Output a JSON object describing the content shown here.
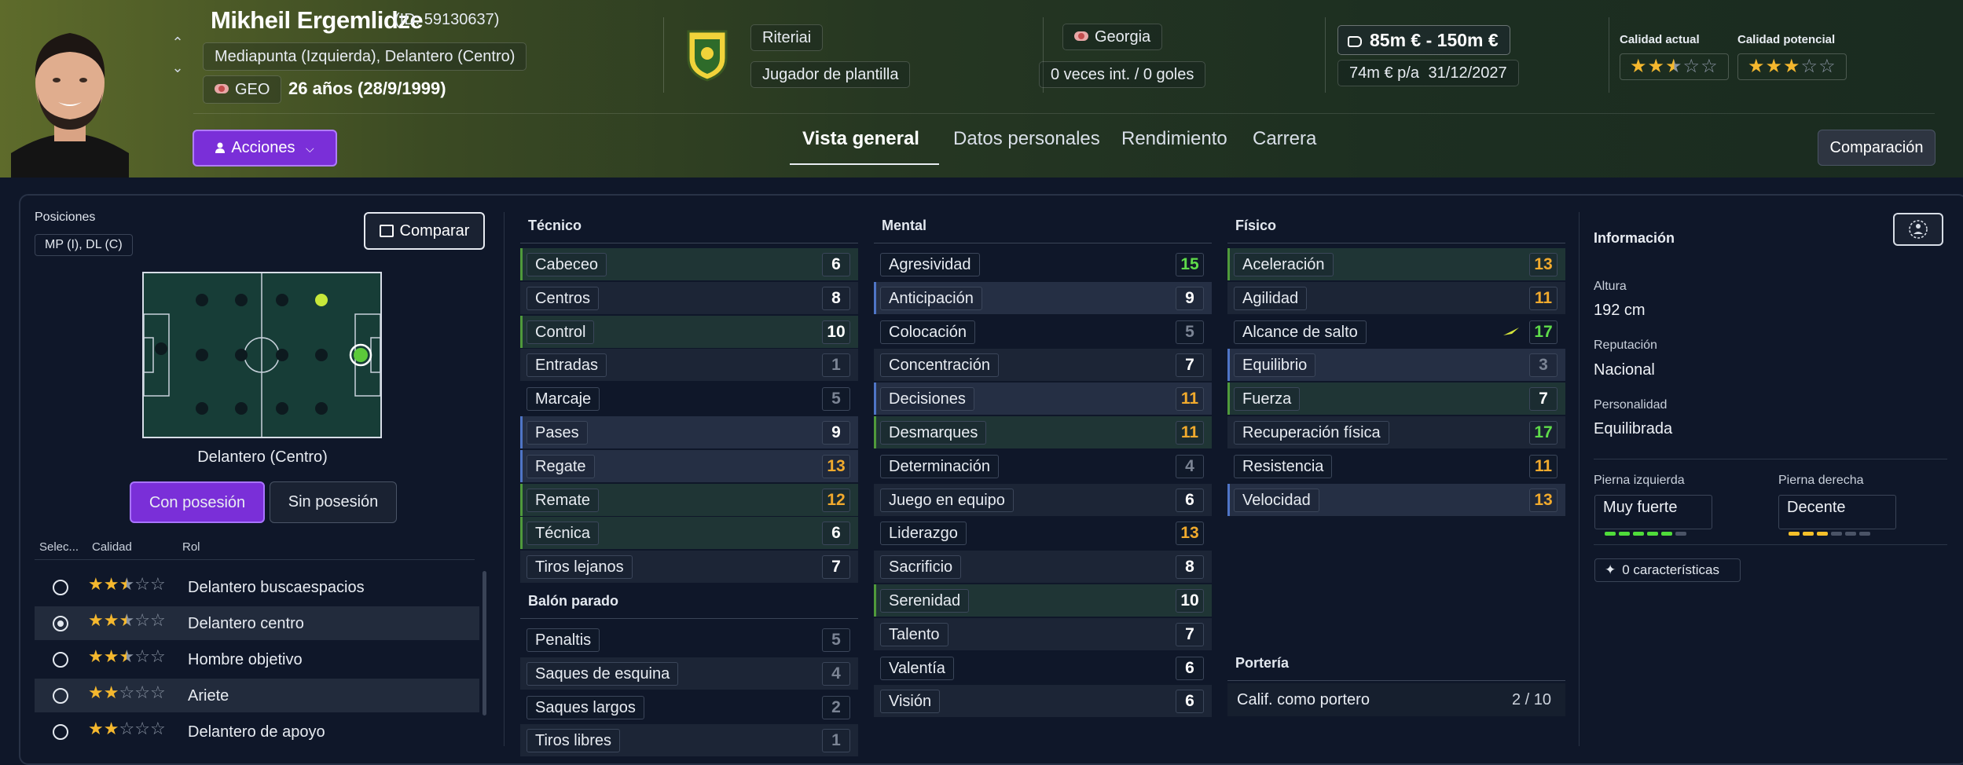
{
  "player": {
    "name": "Mikheil Ergemlidze",
    "id": "(ID: 59130637)",
    "positions": "Mediapunta (Izquierda), Delantero (Centro)",
    "nation_code": "GEO",
    "age": "26 años (28/9/1999)"
  },
  "club": {
    "name": "Riteriai",
    "status": "Jugador de plantilla"
  },
  "nation": {
    "name": "Georgia",
    "caps": "0 veces int. / 0 goles"
  },
  "value": {
    "range": "85m € - 150m €",
    "wage": "74m € p/a",
    "contract_end": "31/12/2027"
  },
  "quality": {
    "current_label": "Calidad actual",
    "current_stars": 2.5,
    "potential_label": "Calidad potencial",
    "potential_stars": 3
  },
  "actions": {
    "label": "Acciones"
  },
  "tabs": [
    {
      "label": "Vista general",
      "active": true
    },
    {
      "label": "Datos personales",
      "active": false
    },
    {
      "label": "Rendimiento",
      "active": false
    },
    {
      "label": "Carrera",
      "active": false
    }
  ],
  "comparacion_label": "Comparación",
  "positions_panel": {
    "title": "Posiciones",
    "chip": "MP (I), DL (C)",
    "compare_label": "Comparar",
    "pitch_title": "Delantero (Centro)",
    "with_ball": "Con posesión",
    "without_ball": "Sin posesión",
    "col_select": "Selec...",
    "col_quality": "Calidad",
    "col_role": "Rol",
    "roles": [
      {
        "name": "Delantero buscaespacios",
        "stars": 2.5,
        "selected": false
      },
      {
        "name": "Delantero centro",
        "stars": 2.5,
        "selected": true
      },
      {
        "name": "Hombre objetivo",
        "stars": 2.5,
        "selected": false
      },
      {
        "name": "Ariete",
        "stars": 2,
        "selected": false
      },
      {
        "name": "Delantero de apoyo",
        "stars": 2,
        "selected": false
      }
    ]
  },
  "tecnico": {
    "title": "Técnico",
    "attrs": [
      {
        "name": "Cabeceo",
        "value": "6"
      },
      {
        "name": "Centros",
        "value": "8"
      },
      {
        "name": "Control",
        "value": "10"
      },
      {
        "name": "Entradas",
        "value": "1"
      },
      {
        "name": "Marcaje",
        "value": "5"
      },
      {
        "name": "Pases",
        "value": "9"
      },
      {
        "name": "Regate",
        "value": "13"
      },
      {
        "name": "Remate",
        "value": "12"
      },
      {
        "name": "Técnica",
        "value": "6"
      },
      {
        "name": "Tiros lejanos",
        "value": "7"
      }
    ]
  },
  "balon_parado": {
    "title": "Balón parado",
    "attrs": [
      {
        "name": "Penaltis",
        "value": "5"
      },
      {
        "name": "Saques de esquina",
        "value": "4"
      },
      {
        "name": "Saques largos",
        "value": "2"
      },
      {
        "name": "Tiros libres",
        "value": "1"
      }
    ]
  },
  "mental": {
    "title": "Mental",
    "attrs": [
      {
        "name": "Agresividad",
        "value": "15"
      },
      {
        "name": "Anticipación",
        "value": "9"
      },
      {
        "name": "Colocación",
        "value": "5"
      },
      {
        "name": "Concentración",
        "value": "7"
      },
      {
        "name": "Decisiones",
        "value": "11"
      },
      {
        "name": "Desmarques",
        "value": "11"
      },
      {
        "name": "Determinación",
        "value": "4"
      },
      {
        "name": "Juego en equipo",
        "value": "6"
      },
      {
        "name": "Liderazgo",
        "value": "13"
      },
      {
        "name": "Sacrificio",
        "value": "8"
      },
      {
        "name": "Serenidad",
        "value": "10"
      },
      {
        "name": "Talento",
        "value": "7"
      },
      {
        "name": "Valentía",
        "value": "6"
      },
      {
        "name": "Visión",
        "value": "6"
      }
    ]
  },
  "fisico": {
    "title": "Físico",
    "attrs": [
      {
        "name": "Aceleración",
        "value": "13"
      },
      {
        "name": "Agilidad",
        "value": "11"
      },
      {
        "name": "Alcance de salto",
        "value": "17"
      },
      {
        "name": "Equilibrio",
        "value": "3"
      },
      {
        "name": "Fuerza",
        "value": "7"
      },
      {
        "name": "Recuperación física",
        "value": "17"
      },
      {
        "name": "Resistencia",
        "value": "11"
      },
      {
        "name": "Velocidad",
        "value": "13"
      }
    ]
  },
  "porteria": {
    "title": "Portería",
    "label": "Calif. como portero",
    "value": "2 / 10"
  },
  "info": {
    "title": "Información",
    "height_label": "Altura",
    "height": "192 cm",
    "reputation_label": "Reputación",
    "reputation": "Nacional",
    "personality_label": "Personalidad",
    "personality": "Equilibrada",
    "left_foot_label": "Pierna izquierda",
    "left_foot": "Muy fuerte",
    "left_foot_level": 5,
    "right_foot_label": "Pierna derecha",
    "right_foot": "Decente",
    "right_foot_level": 3,
    "traits": "0 características"
  },
  "colors": {
    "accent_purple": "#7a2fd8",
    "green_value": "#5fdc4a",
    "orange_value": "#f1aa2d",
    "star": "#f5b82e"
  }
}
